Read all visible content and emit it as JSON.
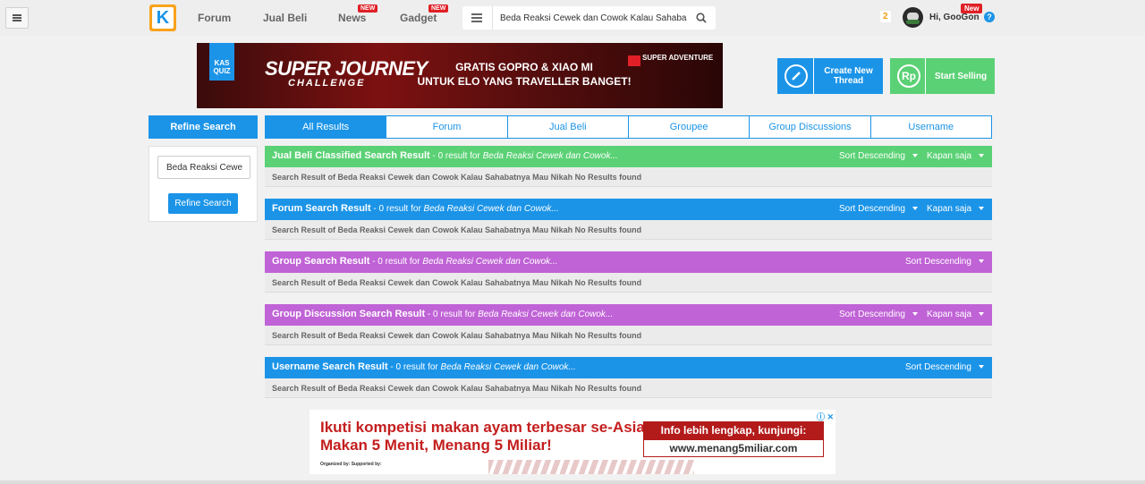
{
  "topbar": {
    "logo_text": "K",
    "nav": [
      {
        "label": "Forum",
        "badge": ""
      },
      {
        "label": "Jual Beli",
        "badge": ""
      },
      {
        "label": "News",
        "badge": "NEW"
      },
      {
        "label": "Gadget",
        "badge": "NEW"
      }
    ],
    "search_value": "Beda Reaksi Cewek dan Cowok Kalau Sahaba",
    "notif_count": "2",
    "user_greeting": "Hi, GooGon",
    "user_badge": "New",
    "help_label": "?"
  },
  "banner": {
    "tag": "KAS QUIZ",
    "title": "SUPER JOURNEY",
    "subtitle": "CHALLENGE",
    "text_line1": "GRATIS GOPRO & XIAO MI",
    "text_line2": "UNTUK ELO YANG TRAVELLER BANGET!",
    "brand": "SUPER ADVENTURE"
  },
  "actions": {
    "create_label": "Create New Thread",
    "create_icon": "pencil-icon",
    "sell_label": "Start Selling",
    "sell_icon_text": "Rp"
  },
  "sidebar": {
    "header": "Refine Search",
    "input_value": "Beda Reaksi Cewe",
    "button_label": "Refine Search"
  },
  "tabs": [
    {
      "label": "All Results",
      "active": true
    },
    {
      "label": "Forum",
      "active": false
    },
    {
      "label": "Jual Beli",
      "active": false
    },
    {
      "label": "Groupee",
      "active": false
    },
    {
      "label": "Group Discussions",
      "active": false
    },
    {
      "label": "Username",
      "active": false
    }
  ],
  "sections": [
    {
      "title": "Jual Beli Classified Search Result",
      "count_text": " - 0 result for ",
      "query": "Beda Reaksi Cewek dan Cowok...",
      "sort": "Sort Descending",
      "time": "Kapan saja",
      "body": "Search Result of Beda Reaksi Cewek dan Cowok Kalau Sahabatnya Mau Nikah No Results found",
      "color": "#5bd175"
    },
    {
      "title": "Forum Search Result",
      "count_text": " - 0 result for ",
      "query": "Beda Reaksi Cewek dan Cowok...",
      "sort": "Sort Descending",
      "time": "Kapan saja",
      "body": "Search Result of Beda Reaksi Cewek dan Cowok Kalau Sahabatnya Mau Nikah No Results found",
      "color": "#1b94e8"
    },
    {
      "title": "Group Search Result",
      "count_text": " - 0 result for ",
      "query": "Beda Reaksi Cewek dan Cowok...",
      "sort": "Sort Descending",
      "time": "",
      "body": "Search Result of Beda Reaksi Cewek dan Cowok Kalau Sahabatnya Mau Nikah No Results found",
      "color": "#c063d6"
    },
    {
      "title": "Group Discussion Search Result",
      "count_text": " - 0 result for ",
      "query": "Beda Reaksi Cewek dan Cowok...",
      "sort": "Sort Descending",
      "time": "Kapan saja",
      "body": "Search Result of Beda Reaksi Cewek dan Cowok Kalau Sahabatnya Mau Nikah No Results found",
      "color": "#c063d6"
    },
    {
      "title": "Username Search Result",
      "count_text": " - 0 result for ",
      "query": "Beda Reaksi Cewek dan Cowok...",
      "sort": "Sort Descending",
      "time": "",
      "body": "Search Result of Beda Reaksi Cewek dan Cowok Kalau Sahabatnya Mau Nikah No Results found",
      "color": "#1b94e8"
    }
  ],
  "ad": {
    "line1": "Ikuti kompetisi makan ayam terbesar se-Asia!",
    "line2": "Makan 5 Menit, Menang 5 Miliar!",
    "info": "Info lebih lengkap, kunjungi:",
    "url": "www.menang5miliar.com",
    "org": "Organized by:          Supported by:",
    "choices": "ⓘ ✕"
  }
}
